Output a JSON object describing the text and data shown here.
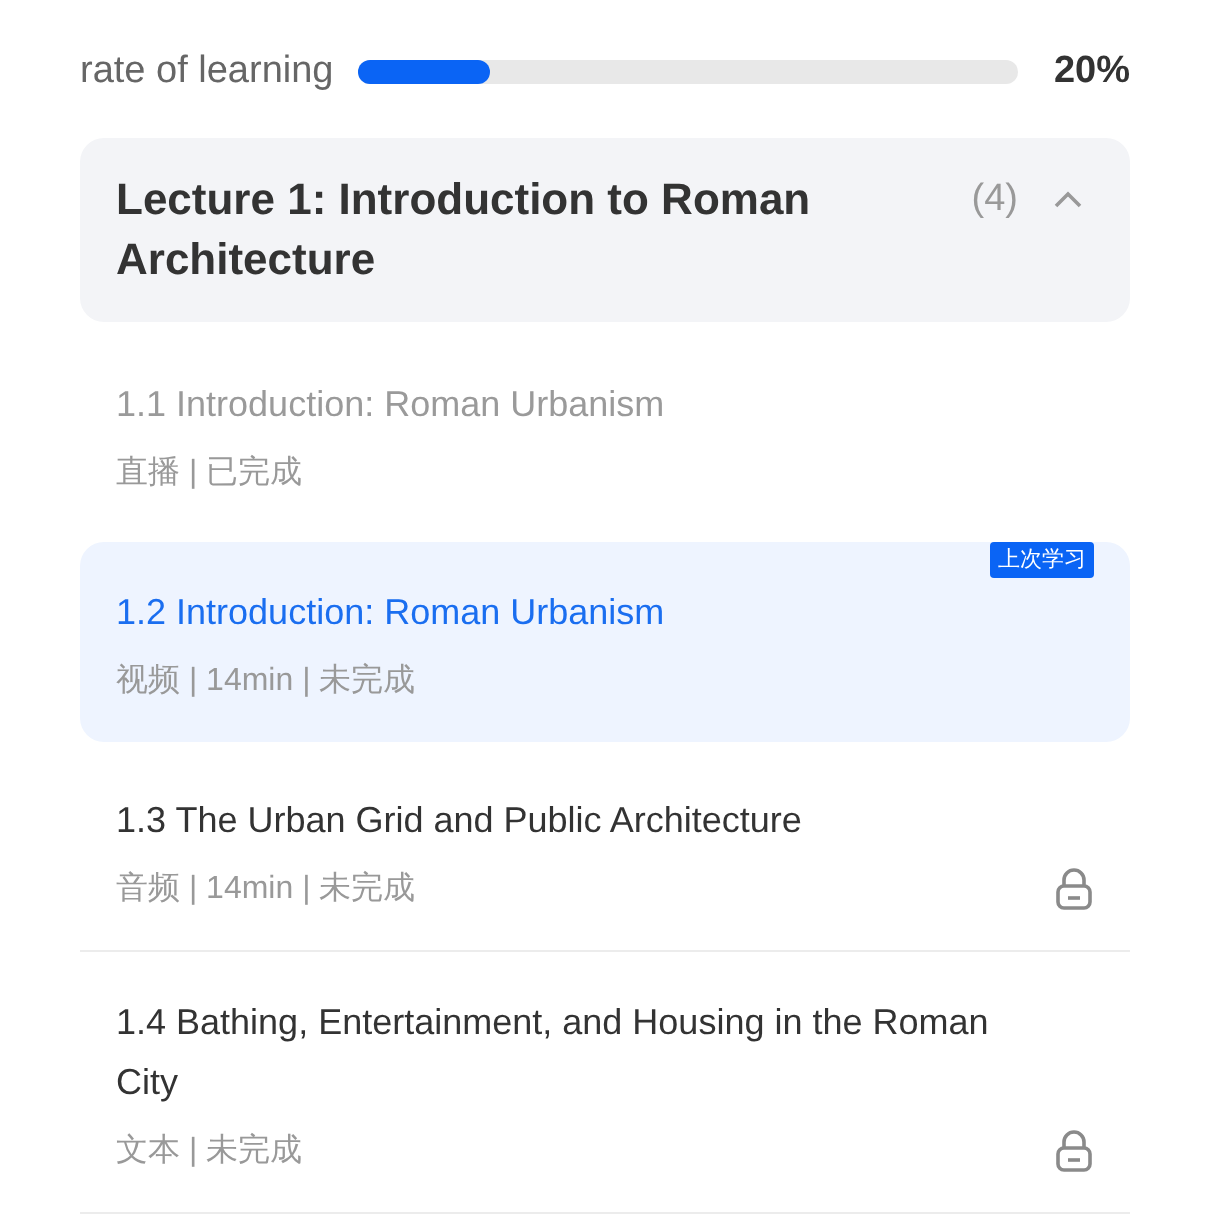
{
  "progress": {
    "label": "rate of learning",
    "level": 0.2,
    "reading": "20%"
  },
  "lecture": {
    "title": "Lecture 1: Introduction to Roman Architecture",
    "count": "(4)",
    "expanded": true,
    "lessons": [
      {
        "title": "1.1 Introduction: Roman Urbanism",
        "meta": "直播 | 已完成",
        "completed": true,
        "selected": false,
        "locked": false
      },
      {
        "title": "1.2 Introduction: Roman Urbanism",
        "meta": "视频 | 14min | 未完成",
        "completed": false,
        "selected": true,
        "locked": false,
        "badge": "上次学习"
      },
      {
        "title": "1.3 The Urban Grid and Public Architecture",
        "meta": "音频 | 14min | 未完成",
        "completed": false,
        "selected": false,
        "locked": true
      },
      {
        "title": "1.4 Bathing, Entertainment, and Housing in the Roman City",
        "meta": "文本 | 未完成",
        "completed": false,
        "selected": false,
        "locked": true
      }
    ]
  }
}
